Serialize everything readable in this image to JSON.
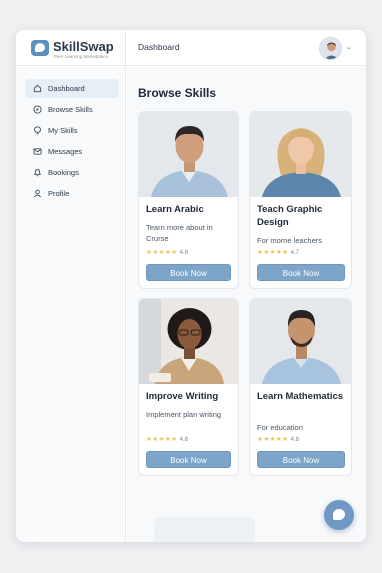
{
  "brand": {
    "name": "SkillSwap",
    "tagline": "Peer Learning Marketplace"
  },
  "header": {
    "title": "Dashboard"
  },
  "sidebar": {
    "items": [
      {
        "label": "Dashboard",
        "icon": "home-icon",
        "active": true
      },
      {
        "label": "Browse Skills",
        "icon": "compass-icon",
        "active": false
      },
      {
        "label": "My Skills",
        "icon": "lightbulb-icon",
        "active": false
      },
      {
        "label": "Messages",
        "icon": "envelope-icon",
        "active": false
      },
      {
        "label": "Bookings",
        "icon": "bell-icon",
        "active": false
      },
      {
        "label": "Profile",
        "icon": "user-icon",
        "active": false
      }
    ]
  },
  "main": {
    "title": "Browse Skills",
    "cards": [
      {
        "title": "Learn Arabic",
        "subtitle": "Tearn more about in Crurse",
        "stars": "★★★★★",
        "rating": "4.8",
        "button": "Book Now"
      },
      {
        "title": "Teach Graphic Design",
        "subtitle": "For morne leachers",
        "stars": "★★★★★",
        "rating": "4.7",
        "button": "Book Now"
      },
      {
        "title": "Improve Writing",
        "subtitle": "Implement plan writing",
        "stars": "★★★★★",
        "rating": "4.8",
        "button": "Book Now"
      },
      {
        "title": "Learn Mathematics",
        "subtitle": "For education",
        "stars": "★★★★★",
        "rating": "4.8",
        "button": "Book Now"
      }
    ]
  },
  "colors": {
    "accent": "#7da4c9",
    "star": "#f2c14e",
    "active_nav": "#e6eef6"
  },
  "fab": {
    "icon": "chat-bubble-icon"
  }
}
